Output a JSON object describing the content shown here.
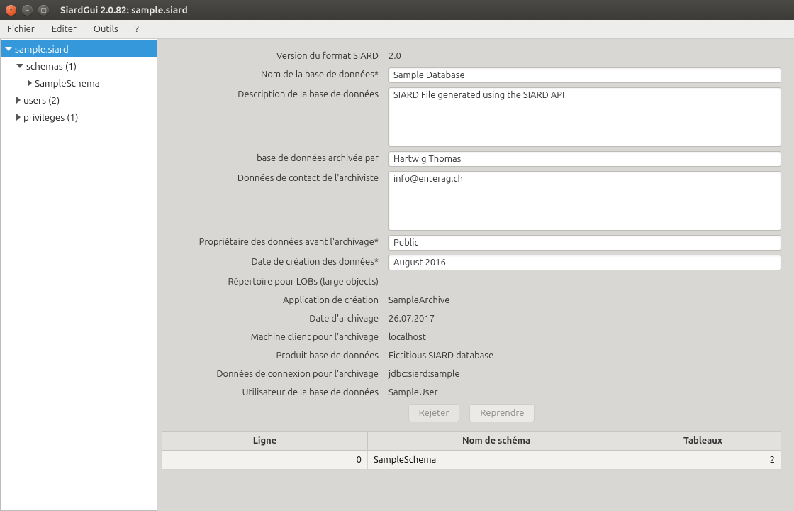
{
  "window": {
    "title": "SiardGui 2.0.82: sample.siard"
  },
  "menu": {
    "file": "Fichier",
    "edit": "Editer",
    "tools": "Outils",
    "help": "?"
  },
  "tree": {
    "root": "sample.siard",
    "schemas": "schemas (1)",
    "schema0": "SampleSchema",
    "users": "users (2)",
    "privileges": "privileges (1)"
  },
  "form": {
    "labels": {
      "siardVersion": "Version du format SIARD",
      "dbName": "Nom de la base de données*",
      "dbDesc": "Description de la base de données",
      "archiver": "base de données archivée par",
      "archiverContact": "Données de contact de l'archiviste",
      "dataOwner": "Propriétaire des données avant l'archivage*",
      "originTs": "Date de création des données*",
      "lobDir": "Répertoire pour LOBs (large objects)",
      "producerApp": "Application de création",
      "archiveDate": "Date d'archivage",
      "clientMachine": "Machine client pour l'archivage",
      "dbProduct": "Produit base de données",
      "connection": "Données de connexion pour l'archivage",
      "dbUser": "Utilisateur de la base de données"
    },
    "values": {
      "siardVersion": "2.0",
      "dbName": "Sample Database",
      "dbDesc": "SIARD File generated using the SIARD API",
      "archiver": "Hartwig Thomas",
      "archiverContact": "info@enterag.ch",
      "dataOwner": "Public",
      "originTs": "August 2016",
      "lobDir": "",
      "producerApp": "SampleArchive",
      "archiveDate": "26.07.2017",
      "clientMachine": "localhost",
      "dbProduct": "Fictitious SIARD database",
      "connection": "jdbc:siard:sample",
      "dbUser": "SampleUser"
    }
  },
  "buttons": {
    "discard": "Rejeter",
    "store": "Reprendre"
  },
  "table": {
    "cols": {
      "row": "Ligne",
      "schema": "Nom de schéma",
      "tables": "Tableaux"
    },
    "row0": {
      "idx": "0",
      "schema": "SampleSchema",
      "tables": "2"
    }
  }
}
